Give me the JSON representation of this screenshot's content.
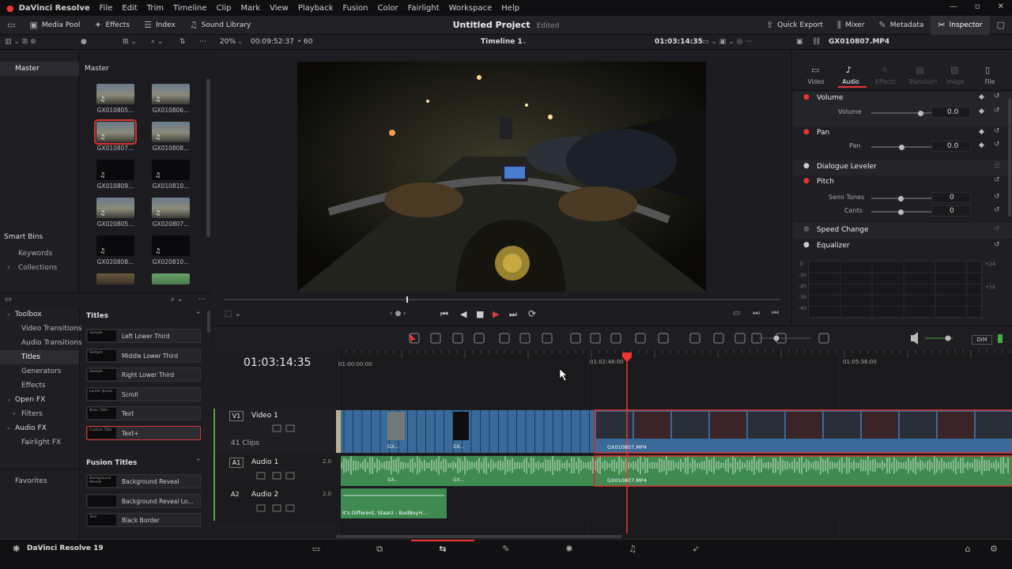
{
  "app": {
    "title": "DaVinci Resolve",
    "menus": [
      "File",
      "Edit",
      "Trim",
      "Timeline",
      "Clip",
      "Mark",
      "View",
      "Playback",
      "Fusion",
      "Color",
      "Fairlight",
      "Workspace",
      "Help"
    ]
  },
  "toolbar": {
    "media_pool": "Media Pool",
    "effects": "Effects",
    "index": "Index",
    "sound_library": "Sound Library",
    "project": "Untitled Project",
    "edited": "Edited",
    "quick_export": "Quick Export",
    "mixer": "Mixer",
    "metadata": "Metadata",
    "inspector": "Inspector"
  },
  "viewer_bar": {
    "zoom": "20%",
    "duration": "00:09:52:37",
    "fps": "60",
    "timeline_name": "Timeline 1",
    "timecode": "01:03:14:35",
    "clip_name": "GX010807.MP4"
  },
  "bins": {
    "master_left": "Master",
    "master_right": "Master",
    "smart_bins": "Smart Bins",
    "keywords": "Keywords",
    "collections": "Collections"
  },
  "media": [
    {
      "name": "GX010805...",
      "kind": "video"
    },
    {
      "name": "GX010806...",
      "kind": "video"
    },
    {
      "name": "GX010807...",
      "kind": "video",
      "selected": true
    },
    {
      "name": "GX010808...",
      "kind": "video"
    },
    {
      "name": "GX010809...",
      "kind": "dark"
    },
    {
      "name": "GX010810...",
      "kind": "dark"
    },
    {
      "name": "GX020805...",
      "kind": "video"
    },
    {
      "name": "GX020807...",
      "kind": "video"
    },
    {
      "name": "GX020808...",
      "kind": "dark"
    },
    {
      "name": "GX020810...",
      "kind": "dark"
    }
  ],
  "inspector": {
    "tabs": [
      "Video",
      "Audio",
      "Effects",
      "Transition",
      "Image",
      "File"
    ],
    "active_tab": "Audio",
    "volume": {
      "title": "Volume",
      "label": "Volume",
      "value": "0.0",
      "level": 0.55
    },
    "pan": {
      "title": "Pan",
      "label": "Pan",
      "value": "0.0",
      "level": 0.5
    },
    "dialogue": "Dialogue Leveler",
    "pitch": {
      "title": "Pitch",
      "semi_label": "Semi Tones",
      "semi_value": "0",
      "cents_label": "Cents",
      "cents_value": "0"
    },
    "speed": "Speed Change",
    "equalizer": "Equalizer",
    "eq_left_ticks": [
      "0",
      "-10",
      "-20",
      "-30",
      "-40"
    ],
    "eq_right_ticks": [
      "+24",
      "+12"
    ]
  },
  "toolbox": {
    "toolbox": "Toolbox",
    "video_trans": "Video Transitions",
    "audio_trans": "Audio Transitions",
    "titles": "Titles",
    "generators": "Generators",
    "effects": "Effects",
    "openfx": "Open FX",
    "filters": "Filters",
    "audiofx": "Audio FX",
    "fairlightfx": "Fairlight FX",
    "favorites": "Favorites"
  },
  "titles_section": {
    "header": "Titles",
    "items": [
      {
        "name": "Left Lower Third",
        "preview": "Sample"
      },
      {
        "name": "Middle Lower Third",
        "preview": "Sample"
      },
      {
        "name": "Right Lower Third",
        "preview": "Sample"
      },
      {
        "name": "Scroll",
        "preview": "Lorem ipsum"
      },
      {
        "name": "Text",
        "preview": "Basic Title"
      },
      {
        "name": "Text+",
        "preview": "Custom Title",
        "selected": true
      }
    ]
  },
  "fusion_titles": {
    "header": "Fusion Titles",
    "items": [
      {
        "name": "Background Reveal",
        "preview": "Background Reveal"
      },
      {
        "name": "Background Reveal Lo...",
        "preview": ""
      },
      {
        "name": "Black Border",
        "preview": "Text"
      }
    ]
  },
  "timeline": {
    "timecode": "01:03:14:35",
    "ruler": [
      "01:00:00:00",
      "01:02:48:00",
      "01:05:36:00"
    ],
    "tracks": [
      {
        "id": "V1",
        "name": "Video 1",
        "info": "41 Clips"
      },
      {
        "id": "A1",
        "name": "Audio 1",
        "channels": "2.0"
      },
      {
        "id": "A2",
        "name": "Audio 2",
        "channels": "2.0"
      }
    ],
    "clip_labels": {
      "v_small1": "GX...",
      "v_small2": "GX...",
      "v_main": "GX010807.MP4",
      "a_small1": "GX...",
      "a_small2": "GX...",
      "a_main": "GX010807.MP4",
      "music": "It's Different, Staarz - BadBoyH..."
    },
    "dim": "DIM"
  },
  "status": {
    "version": "DaVinci Resolve 19"
  }
}
